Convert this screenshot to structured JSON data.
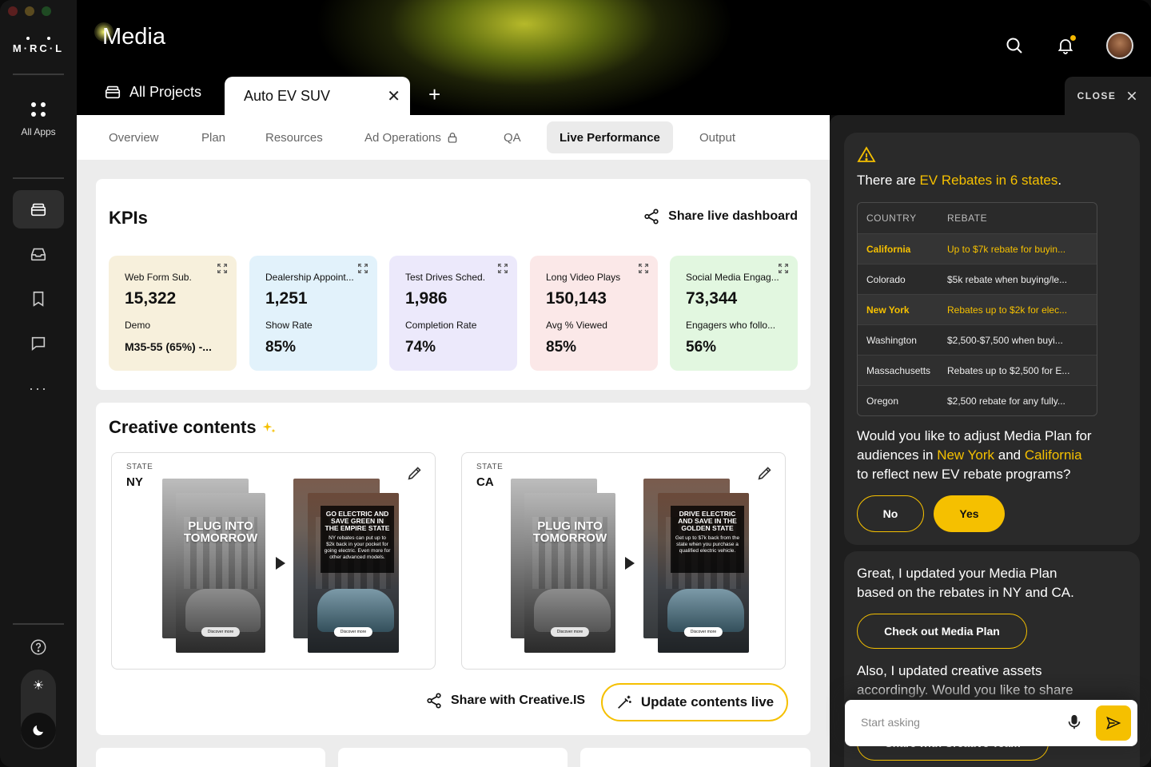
{
  "app": {
    "logo_text": "MRCL",
    "title": "Media",
    "rail": {
      "all_apps_label": "All Apps"
    }
  },
  "tabs": {
    "all_projects": "All Projects",
    "active": "Auto EV SUV",
    "close_label": "CLOSE"
  },
  "subnav": [
    "Overview",
    "Plan",
    "Resources",
    "Ad Operations",
    "QA",
    "Live Performance",
    "Output"
  ],
  "kpis": {
    "title": "KPIs",
    "share_label": "Share live dashboard",
    "cards": [
      {
        "label": "Web Form Sub.",
        "value": "15,322",
        "sub_label": "Demo",
        "sub_value": "M35-55 (65%) -...",
        "color": "#f7f0dc"
      },
      {
        "label": "Dealership Appoint...",
        "value": "1,251",
        "sub_label": "Show Rate",
        "sub_value": "85%",
        "color": "#e2f2fb"
      },
      {
        "label": "Test Drives Sched.",
        "value": "1,986",
        "sub_label": "Completion Rate",
        "sub_value": "74%",
        "color": "#ece9fb"
      },
      {
        "label": "Long Video Plays",
        "value": "150,143",
        "sub_label": "Avg % Viewed",
        "sub_value": "85%",
        "color": "#fbe8e8"
      },
      {
        "label": "Social Media Engag...",
        "value": "73,344",
        "sub_label": "Engagers who follo...",
        "sub_value": "56%",
        "color": "#e2f7e0"
      }
    ]
  },
  "creative": {
    "title": "Creative contents",
    "states": [
      {
        "label": "STATE",
        "value": "NY",
        "before_headline": "PLUG INTO TOMORROW",
        "before_cta": "Discover more",
        "after_headline": "GO ELECTRIC AND SAVE GREEN IN THE EMPIRE STATE",
        "after_body": "NY rebates can put up to $2k back in your pocket for going electric. Even more for other advanced models.",
        "after_cta": "Discover more"
      },
      {
        "label": "STATE",
        "value": "CA",
        "before_headline": "PLUG INTO TOMORROW",
        "before_cta": "Discover more",
        "after_headline": "DRIVE ELECTRIC AND SAVE IN THE GOLDEN STATE",
        "after_body": "Get up to $7k back from the state when you purchase a qualified electric vehicle.",
        "after_cta": "Discover more"
      }
    ],
    "share_label": "Share with Creative.IS",
    "update_label": "Update contents live"
  },
  "assistant": {
    "rebate_prefix": "There are ",
    "rebate_highlight": "EV Rebates in 6 states",
    "rebate_suffix": ".",
    "table": {
      "headers": [
        "COUNTRY",
        "REBATE"
      ],
      "rows": [
        {
          "state": "California",
          "rebate": "Up to $7k rebate for buyin...",
          "highlight": true
        },
        {
          "state": "Colorado",
          "rebate": "$5k rebate when buying/le...",
          "highlight": false
        },
        {
          "state": "New York",
          "rebate": "Rebates up to $2k for elec...",
          "highlight": true
        },
        {
          "state": "Washington",
          "rebate": "$2,500-$7,500 when buyi...",
          "highlight": false
        },
        {
          "state": "Massachusetts",
          "rebate": "Rebates up to $2,500 for E...",
          "highlight": false
        },
        {
          "state": "Oregon",
          "rebate": "$2,500 rebate for any fully...",
          "highlight": false
        }
      ]
    },
    "question_part1": "Would you like to adjust Media Plan for audiences in ",
    "question_ny": "New York",
    "question_and": " and ",
    "question_ca": "California",
    "question_part2": " to reflect new EV rebate programs?",
    "no_label": "No",
    "yes_label": "Yes",
    "updated_text": "Great, I updated your Media Plan based on the rebates in NY and CA.",
    "check_label": "Check out Media Plan",
    "also_text": "Also, I updated creative assets accordingly. Would you like to share",
    "share_team_label": "Share with Creative Team",
    "ask_placeholder": "Start asking"
  },
  "colors": {
    "accent": "#f5c000",
    "rail_bg": "#161616",
    "panel_bg": "#1e1e1e"
  }
}
